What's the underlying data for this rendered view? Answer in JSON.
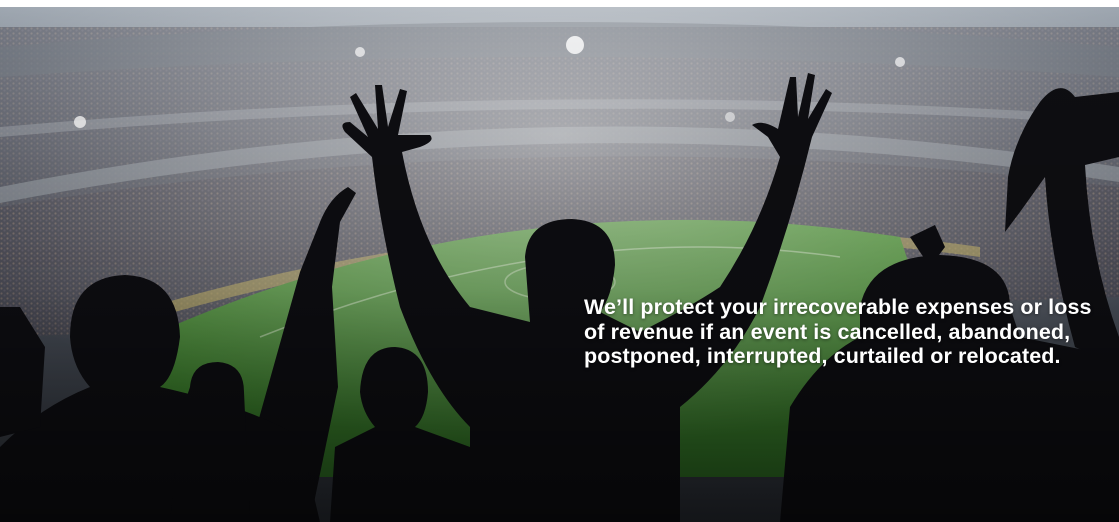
{
  "hero": {
    "image_alt": "Silhouetted football fans cheering in a floodlit stadium",
    "headline": "We’ll protect your irrecoverable expenses or loss of revenue if an event is cancelled, abandoned, postponed, interrupted, curtailed or relocated."
  },
  "colors": {
    "pitch": "#3f8a2e",
    "crowd": "#3a3a44",
    "silhouette": "#0d0d10",
    "text": "#ffffff"
  }
}
